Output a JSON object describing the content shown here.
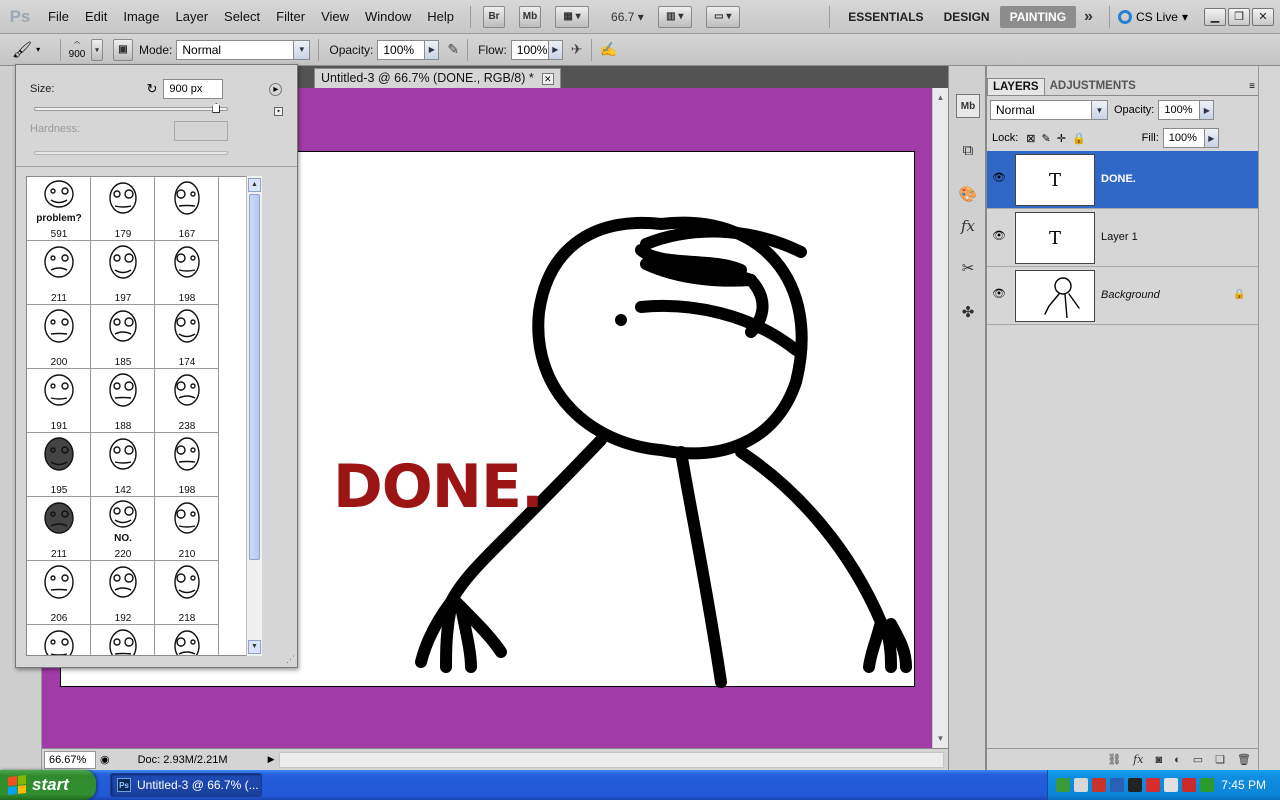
{
  "app": {
    "logo": "Ps"
  },
  "menu": [
    "File",
    "Edit",
    "Image",
    "Layer",
    "Select",
    "Filter",
    "View",
    "Window",
    "Help"
  ],
  "app_bar": {
    "bridge": "Br",
    "mini_bridge": "Mb",
    "zoom": "66.7"
  },
  "workspaces": [
    "ESSENTIALS",
    "DESIGN",
    "PAINTING"
  ],
  "active_workspace": "PAINTING",
  "cs_live": "CS Live",
  "options": {
    "brush_size": "900",
    "mode_label": "Mode:",
    "mode_value": "Normal",
    "opacity_label": "Opacity:",
    "opacity_value": "100%",
    "flow_label": "Flow:",
    "flow_value": "100%"
  },
  "brush_picker": {
    "size_label": "Size:",
    "size_value": "900 px",
    "size_slider_value": 0.94,
    "hardness_label": "Hardness:",
    "hardness_value": "",
    "presets": [
      {
        "size": "591",
        "caption": "problem?"
      },
      {
        "size": "179",
        "caption": ""
      },
      {
        "size": "167",
        "caption": ""
      },
      {
        "size": "211",
        "caption": ""
      },
      {
        "size": "197",
        "caption": ""
      },
      {
        "size": "198",
        "caption": ""
      },
      {
        "size": "200",
        "caption": ""
      },
      {
        "size": "185",
        "caption": ""
      },
      {
        "size": "174",
        "caption": ""
      },
      {
        "size": "191",
        "caption": ""
      },
      {
        "size": "188",
        "caption": ""
      },
      {
        "size": "238",
        "caption": ""
      },
      {
        "size": "195",
        "caption": ""
      },
      {
        "size": "142",
        "caption": ""
      },
      {
        "size": "198",
        "caption": ""
      },
      {
        "size": "211",
        "caption": ""
      },
      {
        "size": "220",
        "caption": "NO."
      },
      {
        "size": "210",
        "caption": ""
      },
      {
        "size": "206",
        "caption": ""
      },
      {
        "size": "192",
        "caption": ""
      },
      {
        "size": "218",
        "caption": ""
      },
      {
        "size": "",
        "caption": ""
      },
      {
        "size": "",
        "caption": ""
      },
      {
        "size": "",
        "caption": ""
      }
    ]
  },
  "document": {
    "tab_title": "Untitled-3 @ 66.7% (DONE., RGB/8) *",
    "canvas_text": "DONE.",
    "canvas_text_color": "#9c1515",
    "background_color": "#a13ba7"
  },
  "status": {
    "zoom": "66.67%",
    "doc": "Doc: 2.93M/2.21M"
  },
  "layers_panel": {
    "tabs": [
      "LAYERS",
      "ADJUSTMENTS"
    ],
    "blend_mode": "Normal",
    "opacity_label": "Opacity:",
    "opacity_value": "100%",
    "lock_label": "Lock:",
    "fill_label": "Fill:",
    "fill_value": "100%",
    "layers": [
      {
        "name": "DONE.",
        "type": "text",
        "selected": true
      },
      {
        "name": "Layer 1",
        "type": "text",
        "selected": false
      },
      {
        "name": "Background",
        "type": "image",
        "selected": false,
        "locked": true
      }
    ]
  },
  "taskbar": {
    "start_label": "start",
    "task_label": "Untitled-3 @ 66.7% (...",
    "clock": "7:45 PM"
  }
}
